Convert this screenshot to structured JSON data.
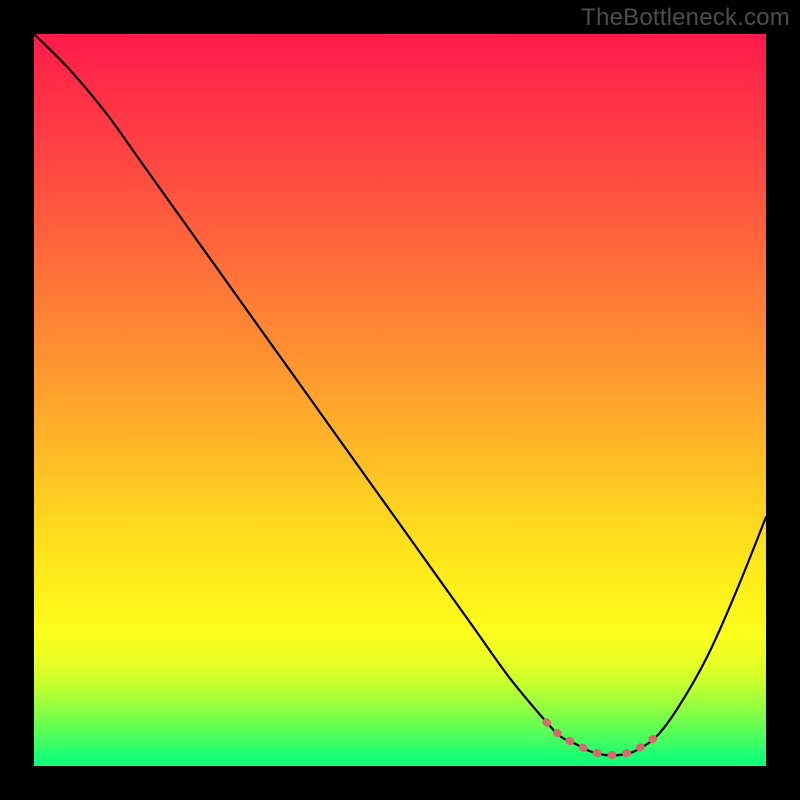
{
  "watermark": "TheBottleneck.com",
  "chart_data": {
    "type": "line",
    "title": "",
    "xlabel": "",
    "ylabel": "",
    "xlim": [
      0,
      100
    ],
    "ylim": [
      0,
      100
    ],
    "x": [
      0,
      5,
      10,
      15,
      20,
      25,
      30,
      35,
      40,
      45,
      50,
      55,
      60,
      65,
      70,
      72,
      74,
      76,
      78,
      80,
      82,
      85,
      88,
      92,
      96,
      100
    ],
    "y": [
      100,
      95,
      89,
      82,
      75,
      68,
      61,
      54,
      47,
      40,
      33,
      26,
      19,
      12,
      6,
      4,
      3,
      2,
      1.5,
      1.5,
      2,
      4,
      8,
      15,
      24,
      34
    ],
    "annotation_region": {
      "x_from": 66,
      "x_to": 85
    }
  }
}
